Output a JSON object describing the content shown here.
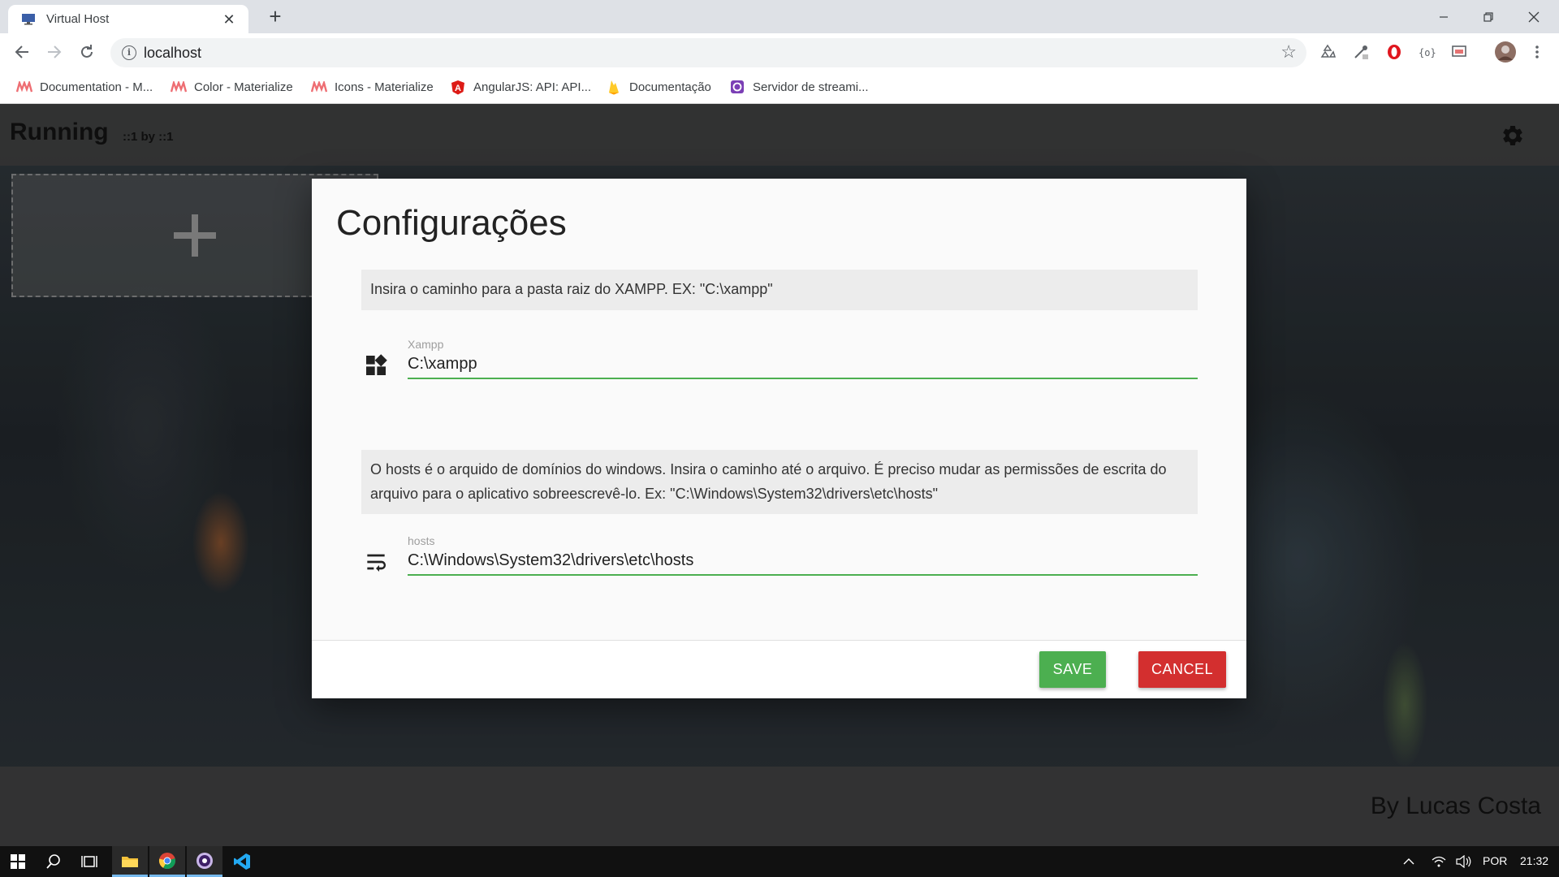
{
  "browser": {
    "tab_title": "Virtual Host",
    "url": "localhost",
    "bookmarks": [
      {
        "label": "Documentation - M...",
        "icon": "materialize-icon"
      },
      {
        "label": "Color - Materialize",
        "icon": "materialize-icon"
      },
      {
        "label": "Icons - Materialize",
        "icon": "materialize-icon"
      },
      {
        "label": "AngularJS: API: API...",
        "icon": "angular-icon"
      },
      {
        "label": "Documentação",
        "icon": "firebase-icon"
      },
      {
        "label": "Servidor de streami...",
        "icon": "obs-icon"
      }
    ]
  },
  "header": {
    "title": "Running",
    "subtitle": "::1 by ::1"
  },
  "modal": {
    "title": "Configurações",
    "xampp_info": "Insira o caminho para a pasta raiz do XAMPP. EX: \"C:\\xampp\"",
    "xampp_label": "Xampp",
    "xampp_value": "C:\\xampp",
    "hosts_info": "O hosts é o arquido de domínios do windows. Insira o caminho até o arquivo. É preciso mudar as permissões de escrita do arquivo para o aplicativo sobreescrevê-lo. Ex: \"C:\\Windows\\System32\\drivers\\etc\\hosts\"",
    "hosts_label": "hosts",
    "hosts_value": "C:\\Windows\\System32\\drivers\\etc\\hosts",
    "save_label": "SAVE",
    "cancel_label": "CANCEL"
  },
  "footer": {
    "text": "By Lucas Costa"
  },
  "taskbar": {
    "language": "POR",
    "time": "21:32"
  },
  "colors": {
    "save": "#4caf50",
    "cancel": "#d32f2f",
    "input_underline": "#4caf50"
  }
}
